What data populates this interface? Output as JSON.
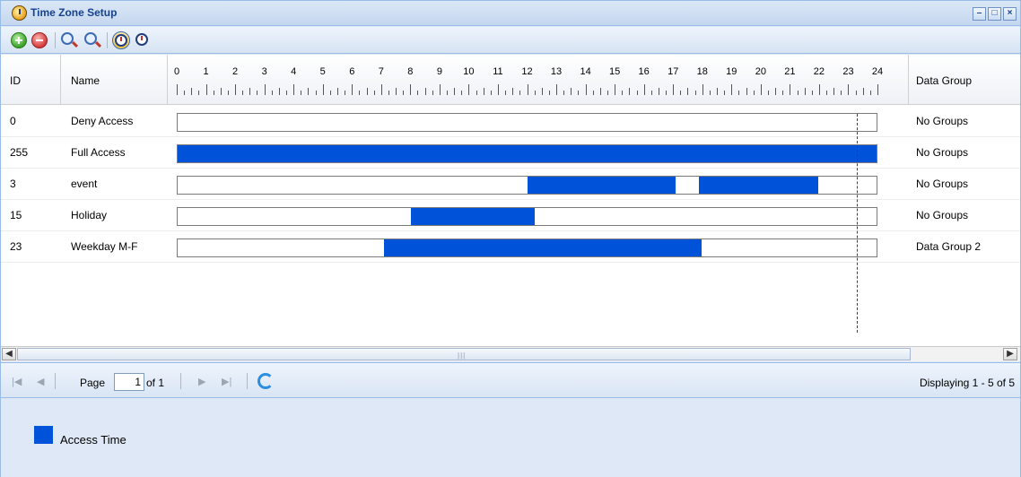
{
  "window": {
    "title": "Time Zone Setup",
    "controls": {
      "minimize": "–",
      "maximize": "□",
      "close": "×"
    }
  },
  "toolbar": {
    "icons": [
      "add-icon",
      "delete-icon",
      "zoom-in-icon",
      "zoom-out-icon",
      "clock-icon",
      "clock-settings-icon"
    ]
  },
  "grid": {
    "columns": {
      "id": "ID",
      "name": "Name",
      "data_group": "Data Group"
    },
    "hours": [
      "0",
      "1",
      "2",
      "3",
      "4",
      "5",
      "6",
      "7",
      "8",
      "9",
      "10",
      "11",
      "12",
      "13",
      "14",
      "15",
      "16",
      "17",
      "18",
      "19",
      "20",
      "21",
      "22",
      "23",
      "24"
    ],
    "current_time_hour": 23.3,
    "rows": [
      {
        "id": "0",
        "name": "Deny Access",
        "data_group": "No Groups",
        "intervals": []
      },
      {
        "id": "255",
        "name": "Full Access",
        "data_group": "No Groups",
        "intervals": [
          [
            0,
            24
          ]
        ]
      },
      {
        "id": "3",
        "name": "event",
        "data_group": "No Groups",
        "intervals": [
          [
            12,
            17.1
          ],
          [
            17.9,
            22
          ]
        ]
      },
      {
        "id": "15",
        "name": "Holiday",
        "data_group": "No Groups",
        "intervals": [
          [
            8,
            12.25
          ]
        ]
      },
      {
        "id": "23",
        "name": "Weekday M-F",
        "data_group": "Data Group 2",
        "intervals": [
          [
            7.1,
            18
          ]
        ]
      }
    ]
  },
  "pager": {
    "page_label": "Page",
    "page_value": "1",
    "of_label": "of 1",
    "display_text": "Displaying 1 - 5 of 5"
  },
  "legend": {
    "label": "Access Time",
    "color": "#0052d9"
  }
}
